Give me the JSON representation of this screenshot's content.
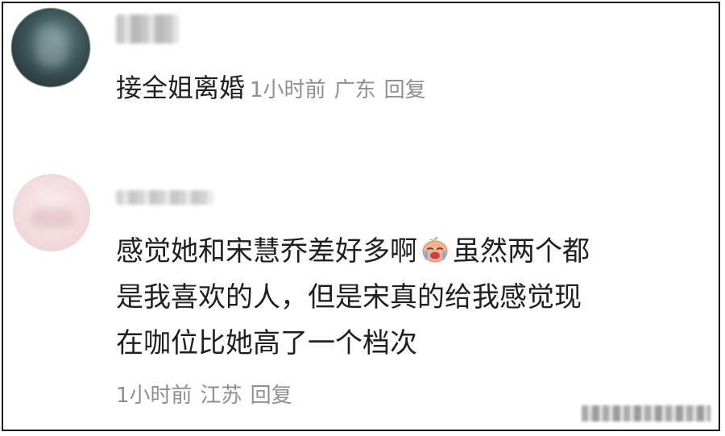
{
  "comments": [
    {
      "text": "接全姐离婚",
      "time": "1小时前",
      "location": "广东",
      "reply_label": "回复"
    },
    {
      "text_lines": [
        "感觉她和宋慧乔差好多啊",
        "虽然两个都",
        "是我喜欢的人，但是宋真的给我感觉现",
        "在咖位比她高了一个档次"
      ],
      "emoji": "crying-face-emoji",
      "time": "1小时前",
      "location": "江苏",
      "reply_label": "回复"
    }
  ],
  "colors": {
    "text": "#1f1f1f",
    "meta": "#8f8f8f",
    "border": "#1a1a1a"
  }
}
